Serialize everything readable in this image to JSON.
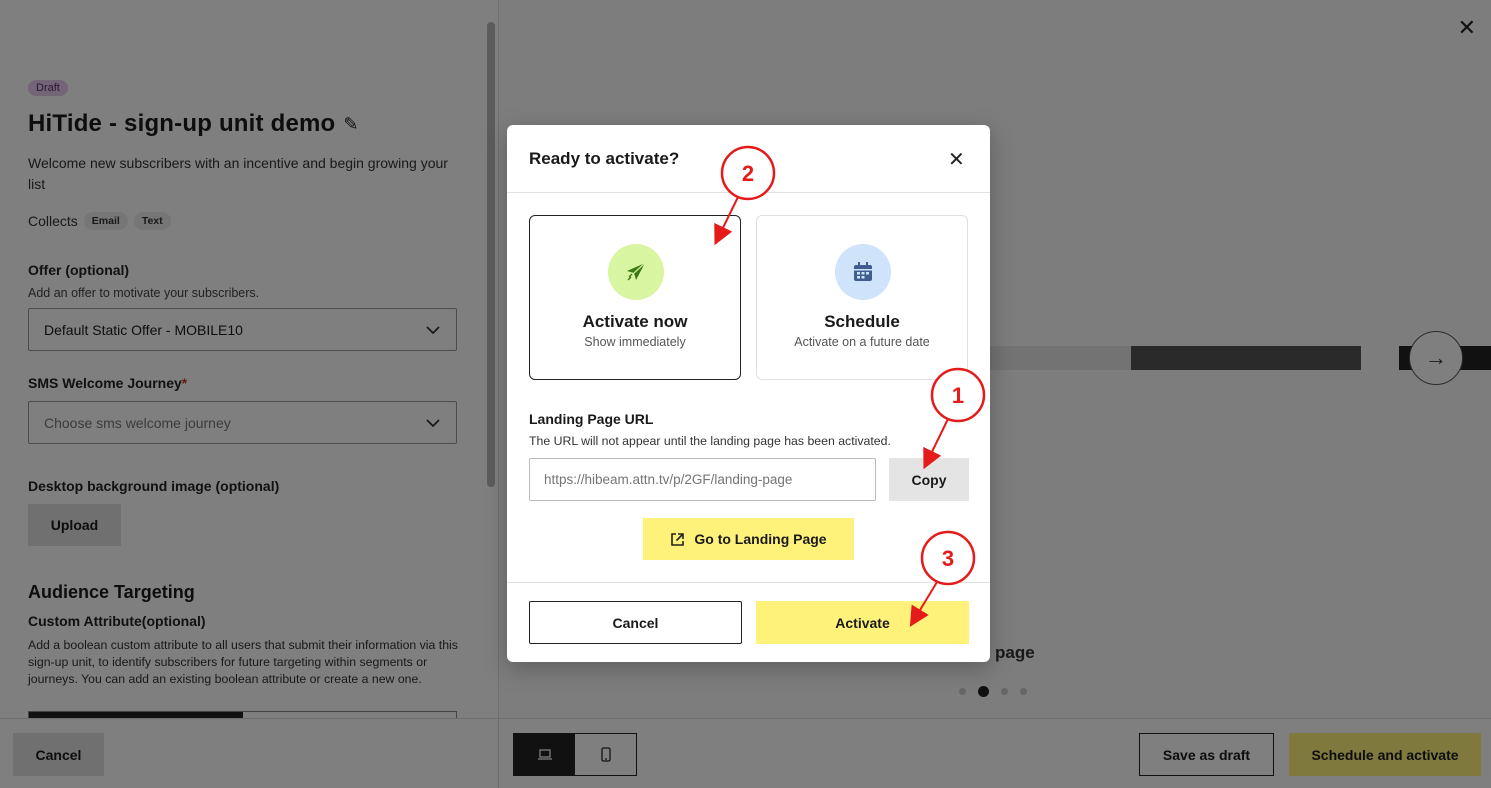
{
  "left_panel": {
    "badge": "Draft",
    "title": "HiTide - sign-up unit demo",
    "description": "Welcome new subscribers with an incentive and begin growing your list",
    "collects_label": "Collects",
    "collects_chips": [
      "Email",
      "Text"
    ],
    "offer": {
      "label": "Offer (optional)",
      "help": "Add an offer to motivate your subscribers.",
      "value": "Default Static Offer - MOBILE10"
    },
    "sms_journey": {
      "label": "SMS Welcome Journey",
      "required_mark": "*",
      "placeholder": "Choose sms welcome journey"
    },
    "desktop_bg": {
      "label": "Desktop background image (optional)",
      "upload": "Upload"
    },
    "audience": {
      "heading": "Audience Targeting",
      "custom_label": "Custom Attribute(optional)",
      "custom_desc": "Add a boolean custom attribute to all users that submit their information via this sign-up unit, to identify subscribers for future targeting within segments or journeys. You can add an existing boolean attribute or create a new one."
    },
    "cancel": "Cancel"
  },
  "preview": {
    "peek_text": "page",
    "active_dot": 1,
    "dot_count": 4
  },
  "footer": {
    "save_draft": "Save as draft",
    "schedule_activate": "Schedule and activate"
  },
  "modal": {
    "title": "Ready to activate?",
    "options": [
      {
        "name": "Activate now",
        "sub": "Show immediately",
        "icon": "paper-plane-icon",
        "selected": true
      },
      {
        "name": "Schedule",
        "sub": "Activate on a future date",
        "icon": "calendar-icon",
        "selected": false
      }
    ],
    "url_label": "Landing Page URL",
    "url_help": "The URL will not appear until the landing page has been activated.",
    "url_placeholder": "https://hibeam.attn.tv/p/2GF/landing-page",
    "copy": "Copy",
    "goto": "Go to Landing Page",
    "cancel": "Cancel",
    "activate": "Activate"
  },
  "annotations": [
    "1",
    "2",
    "3"
  ],
  "colors": {
    "accent_yellow": "#fff27a",
    "annotation_red": "#e51b1b",
    "icon_green_bg": "#d8f5a2",
    "icon_blue_bg": "#cfe3fb"
  }
}
